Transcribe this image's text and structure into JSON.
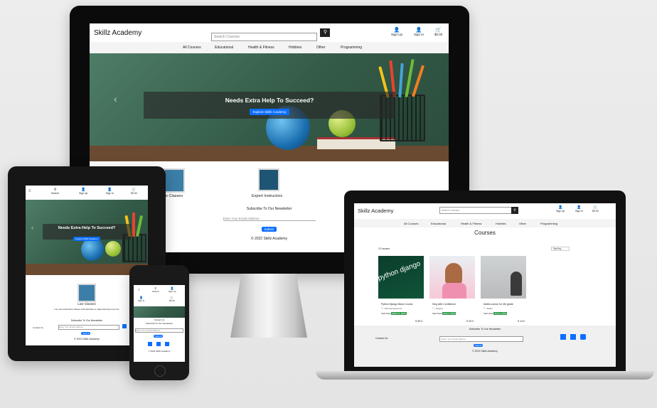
{
  "brand": "Skillz Academy",
  "search": {
    "placeholder": "Search Courses"
  },
  "header_icons": {
    "signup": "Sign Up",
    "signin": "Sign In",
    "cart": "$0.00",
    "search": "Search"
  },
  "nav": [
    "All Courses",
    "Educational",
    "Health & Fitness",
    "Hobbies",
    "Other",
    "Programming"
  ],
  "hero": {
    "headline": "Needs Extra Help To Succeed?",
    "button": "Explore Skillz Academy"
  },
  "features": {
    "live_title": "Live Classes",
    "live_title_cut": "ive Classes",
    "expert_title": "Expert Instructors",
    "live_desc": "Live and interactive classes with activities to make learning more fun"
  },
  "newsletter": {
    "title": "Subscribe To Our Newsletter",
    "placeholder": "Enter Your Email Address",
    "button": "Submit"
  },
  "footer": {
    "copyright": "© 2022 Skillz Academy",
    "contact": "Contact Us"
  },
  "courses_page": {
    "title": "Courses",
    "count": "3 Courses",
    "sort": "Sort by...",
    "cards": [
      {
        "title": "Python Django Basic Course",
        "category": "Web Development",
        "start_label": "Start Date",
        "date": "March 1, 2022",
        "price": "€ 59.0",
        "image_text": "python django"
      },
      {
        "title": "Sing with Confidence",
        "category": "Singing",
        "start_label": "Start Date",
        "date": "April 7, 2022",
        "price": "€ 29.0",
        "image_text": ""
      },
      {
        "title": "Maths course for 4th grade",
        "category": "Maths",
        "start_label": "Start Date",
        "date": "April 1, 2022",
        "price": "€ 14.0",
        "image_text": ""
      }
    ]
  },
  "colors": {
    "accent": "#0d6efd",
    "date_badge": "#2e9a4a",
    "social": "#0d6efd"
  },
  "icons": [
    "user-plus-icon",
    "user-icon",
    "cart-icon",
    "search-icon",
    "menu-icon",
    "twitter-icon",
    "facebook-icon",
    "instagram-icon",
    "chevron-left-icon"
  ]
}
